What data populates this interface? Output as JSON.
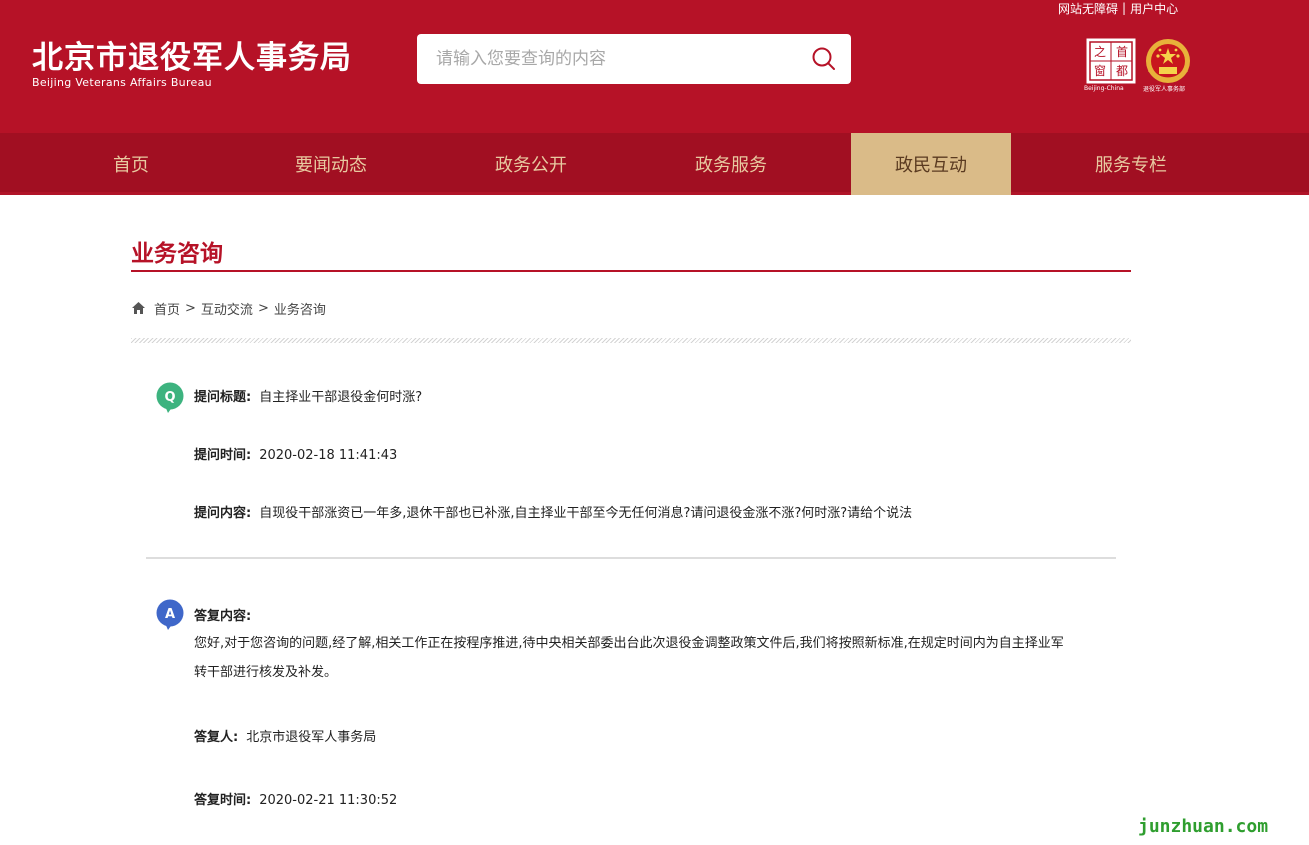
{
  "header": {
    "title": "北京市退役军人事务局",
    "subtitle": "Beijing Veterans Affairs Bureau",
    "top_links": [
      "网站无障碍",
      "用户中心"
    ],
    "top_links_separator": "|",
    "search_placeholder": "请输入您要查询的内容",
    "logos": {
      "shoudu_chars": [
        "首",
        "都",
        "之",
        "窗"
      ],
      "shoudu_caption": "Beijing-China",
      "emblem_caption": "退役军人事务部"
    }
  },
  "nav": {
    "items": [
      {
        "label": "首页"
      },
      {
        "label": "要闻动态"
      },
      {
        "label": "政务公开"
      },
      {
        "label": "政务服务"
      },
      {
        "label": "政民互动"
      },
      {
        "label": "服务专栏"
      }
    ],
    "active_index": 4
  },
  "section": {
    "title": "业务咨询"
  },
  "breadcrumb": {
    "items": [
      "首页",
      "互动交流",
      "业务咨询"
    ],
    "separator": ">"
  },
  "question": {
    "badge": "Q",
    "title_label": "提问标题:",
    "title": "自主择业干部退役金何时涨?",
    "time_label": "提问时间:",
    "time": "2020-02-18 11:41:43",
    "content_label": "提问内容:",
    "content": "自现役干部涨资已一年多,退休干部也已补涨,自主择业干部至今无任何消息?请问退役金涨不涨?何时涨?请给个说法"
  },
  "answer": {
    "badge": "A",
    "content_label": "答复内容:",
    "content": "您好,对于您咨询的问题,经了解,相关工作正在按程序推进,待中央相关部委出台此次退役金调整政策文件后,我们将按照新标准,在规定时间内为自主择业军转干部进行核发及补发。",
    "responder_label": "答复人:",
    "responder": "北京市退役军人事务局",
    "time_label": "答复时间:",
    "time": "2020-02-21 11:30:52"
  },
  "watermark": "junzhuan.com",
  "colors": {
    "header_red": "#b61227",
    "nav_red": "#a10f22",
    "nav_text": "#e8c9a0",
    "nav_active_bg": "#dabb88",
    "question_badge": "#3db37f",
    "answer_badge": "#3f67c9",
    "watermark": "#2f9e2f"
  }
}
